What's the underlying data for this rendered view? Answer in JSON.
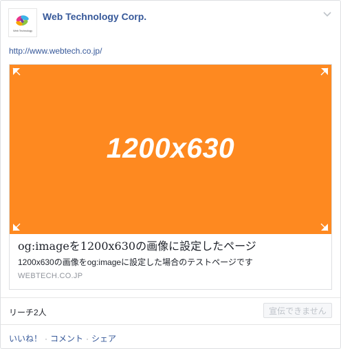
{
  "header": {
    "page_name": "Web Technology Corp.",
    "logo_text": "Web Technology"
  },
  "post": {
    "link_url": "http://www.webtech.co.jp/"
  },
  "link_card": {
    "image_label": "1200x630",
    "image_color": "#fe8920",
    "title": "og:imageを1200x630の画像に設定したページ",
    "description": "1200x630の画像をog:imageに設定した場合のテストページです",
    "domain": "WEBTECH.CO.JP"
  },
  "stats": {
    "reach": "リーチ2人",
    "promote_label": "宣伝できません"
  },
  "actions": {
    "like": "いいね！",
    "comment": "コメント",
    "share": "シェア",
    "separator": "·"
  },
  "colors": {
    "link": "#365899",
    "muted": "#90949c",
    "border": "#dddfe2"
  }
}
